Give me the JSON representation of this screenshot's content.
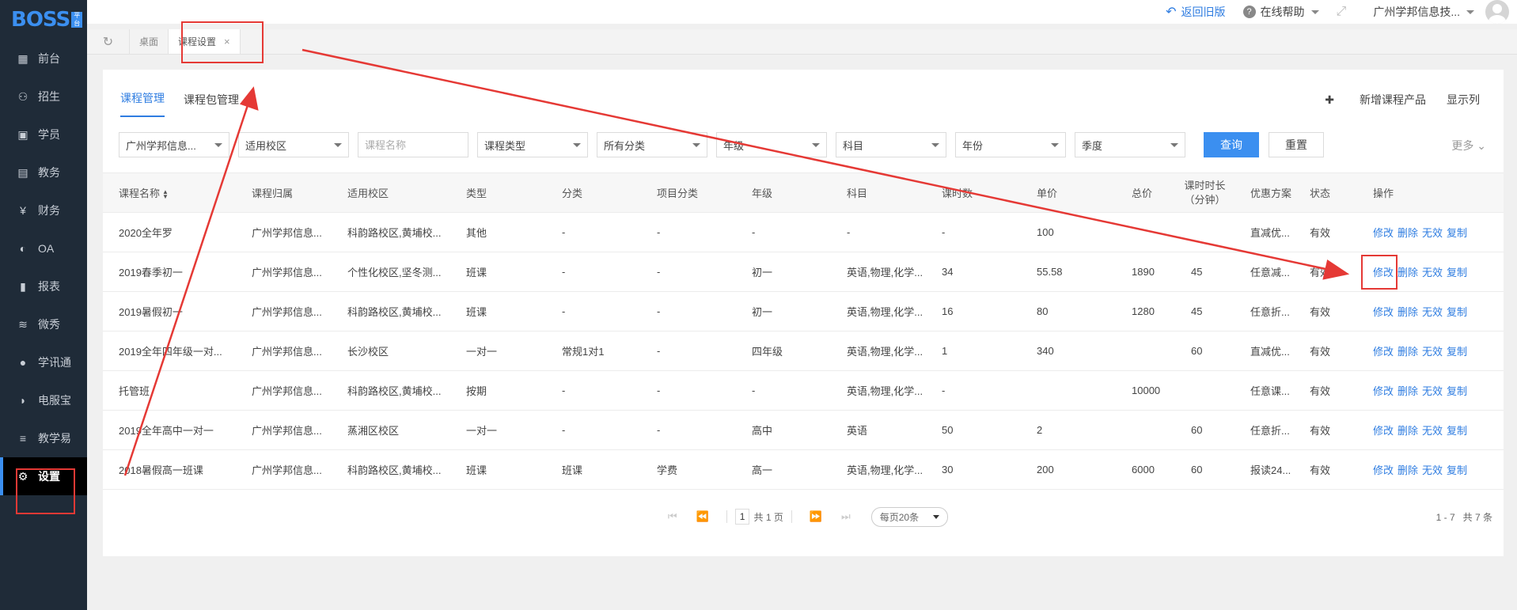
{
  "logo": {
    "text": "BOSS",
    "badge": "平台"
  },
  "sidebar": {
    "items": [
      {
        "label": "前台",
        "icon": "calendar-icon"
      },
      {
        "label": "招生",
        "icon": "user-add-icon"
      },
      {
        "label": "学员",
        "icon": "student-icon"
      },
      {
        "label": "教务",
        "icon": "book-icon"
      },
      {
        "label": "财务",
        "icon": "yen-icon"
      },
      {
        "label": "OA",
        "icon": "toggle-icon"
      },
      {
        "label": "报表",
        "icon": "bar-chart-icon"
      },
      {
        "label": "微秀",
        "icon": "wave-icon"
      },
      {
        "label": "学讯通",
        "icon": "location-icon"
      },
      {
        "label": "电服宝",
        "icon": "phone-icon"
      },
      {
        "label": "教学易",
        "icon": "layers-icon"
      },
      {
        "label": "设置",
        "icon": "gear-icon",
        "active": true
      }
    ]
  },
  "header": {
    "back_old": "返回旧版",
    "help": "在线帮助",
    "org": "广州学邦信息技..."
  },
  "tabs": {
    "desk": "桌面",
    "course_settings": "课程设置"
  },
  "subtabs": {
    "course_mgmt": "课程管理",
    "package_mgmt": "课程包管理",
    "add_product": "新增课程产品",
    "show_columns": "显示列"
  },
  "filters": {
    "org": "广州学邦信息...",
    "campus": "适用校区",
    "course_name_placeholder": "课程名称",
    "course_type": "课程类型",
    "category": "所有分类",
    "grade": "年级",
    "subject": "科目",
    "year": "年份",
    "season": "季度",
    "query": "查询",
    "reset": "重置",
    "more": "更多"
  },
  "table": {
    "headers": {
      "name": "课程名称",
      "belong": "课程归属",
      "campus": "适用校区",
      "type": "类型",
      "category": "分类",
      "project": "项目分类",
      "grade": "年级",
      "subject": "科目",
      "hours": "课时数",
      "unit_price": "单价",
      "total": "总价",
      "duration_1": "课时时长",
      "duration_2": "（分钟）",
      "discount": "优惠方案",
      "status": "状态",
      "ops": "操作"
    },
    "rows": [
      {
        "name": "2020全年罗",
        "belong": "广州学邦信息...",
        "campus": "科韵路校区,黄埔校...",
        "type": "其他",
        "category": "-",
        "project": "-",
        "grade": "-",
        "subject": "-",
        "hours": "-",
        "unit_price": "100",
        "total": "",
        "duration": "",
        "discount": "直减优...",
        "status": "有效"
      },
      {
        "name": "2019春季初一",
        "belong": "广州学邦信息...",
        "campus": "个性化校区,坚冬测...",
        "type": "班课",
        "category": "-",
        "project": "-",
        "grade": "初一",
        "subject": "英语,物理,化学...",
        "hours": "34",
        "unit_price": "55.58",
        "total": "1890",
        "duration": "45",
        "discount": "任意减...",
        "status": "有效"
      },
      {
        "name": "2019暑假初一",
        "belong": "广州学邦信息...",
        "campus": "科韵路校区,黄埔校...",
        "type": "班课",
        "category": "-",
        "project": "-",
        "grade": "初一",
        "subject": "英语,物理,化学...",
        "hours": "16",
        "unit_price": "80",
        "total": "1280",
        "duration": "45",
        "discount": "任意折...",
        "status": "有效"
      },
      {
        "name": "2019全年四年级一对...",
        "belong": "广州学邦信息...",
        "campus": "长沙校区",
        "type": "一对一",
        "category": "常规1对1",
        "project": "-",
        "grade": "四年级",
        "subject": "英语,物理,化学...",
        "hours": "1",
        "unit_price": "340",
        "total": "",
        "duration": "60",
        "discount": "直减优...",
        "status": "有效"
      },
      {
        "name": "托管班",
        "belong": "广州学邦信息...",
        "campus": "科韵路校区,黄埔校...",
        "type": "按期",
        "category": "-",
        "project": "-",
        "grade": "-",
        "subject": "英语,物理,化学...",
        "hours": "-",
        "unit_price": "",
        "total": "10000",
        "duration": "",
        "discount": "任意课...",
        "status": "有效"
      },
      {
        "name": "2019全年高中一对一",
        "belong": "广州学邦信息...",
        "campus": "蒸湘区校区",
        "type": "一对一",
        "category": "-",
        "project": "-",
        "grade": "高中",
        "subject": "英语",
        "hours": "50",
        "unit_price": "2",
        "total": "",
        "duration": "60",
        "discount": "任意折...",
        "status": "有效"
      },
      {
        "name": "2018暑假高一班课",
        "belong": "广州学邦信息...",
        "campus": "科韵路校区,黄埔校...",
        "type": "班课",
        "category": "班课",
        "project": "学费",
        "grade": "高一",
        "subject": "英语,物理,化学...",
        "hours": "30",
        "unit_price": "200",
        "total": "6000",
        "duration": "60",
        "discount": "报读24...",
        "status": "有效"
      }
    ],
    "ops": {
      "edit": "修改",
      "delete": "删除",
      "invalid": "无效",
      "copy": "复制"
    }
  },
  "pager": {
    "page": "1",
    "total_pages": "共 1 页",
    "page_size": "每页20条",
    "range": "1 - 7",
    "total": "共 7 条"
  },
  "colors": {
    "accent": "#3b8ff0",
    "sidebar": "#1f2b38",
    "annotation": "#e53935"
  }
}
